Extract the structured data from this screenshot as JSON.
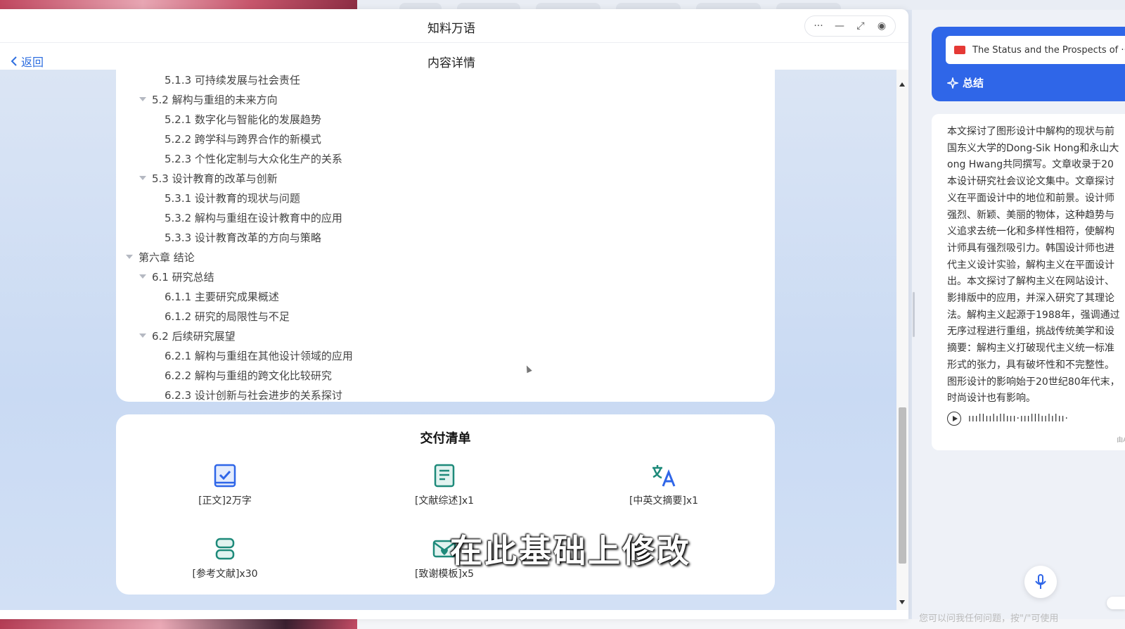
{
  "window": {
    "app_title": "知料万语",
    "controls": {
      "more": "···",
      "minimize": "—",
      "maximize": "⤢",
      "record": "◉"
    }
  },
  "nav": {
    "back_label": "返回",
    "title": "内容详情"
  },
  "toc": [
    {
      "level": 3,
      "text": "5.1.3 可持续发展与社会责任"
    },
    {
      "level": 2,
      "text": "5.2 解构与重组的未来方向"
    },
    {
      "level": 3,
      "text": "5.2.1 数字化与智能化的发展趋势"
    },
    {
      "level": 3,
      "text": "5.2.2 跨学科与跨界合作的新模式"
    },
    {
      "level": 3,
      "text": "5.2.3 个性化定制与大众化生产的关系"
    },
    {
      "level": 2,
      "text": "5.3 设计教育的改革与创新"
    },
    {
      "level": 3,
      "text": "5.3.1 设计教育的现状与问题"
    },
    {
      "level": 3,
      "text": "5.3.2 解构与重组在设计教育中的应用"
    },
    {
      "level": 3,
      "text": "5.3.3 设计教育改革的方向与策略"
    },
    {
      "level": 1,
      "text": "第六章 结论"
    },
    {
      "level": 2,
      "text": "6.1 研究总结"
    },
    {
      "level": 3,
      "text": "6.1.1 主要研究成果概述"
    },
    {
      "level": 3,
      "text": "6.1.2 研究的局限性与不足"
    },
    {
      "level": 2,
      "text": "6.2 后续研究展望"
    },
    {
      "level": 3,
      "text": "6.2.1 解构与重组在其他设计领域的应用"
    },
    {
      "level": 3,
      "text": "6.2.2 解构与重组的跨文化比较研究"
    },
    {
      "level": 3,
      "text": "6.2.3 设计创新与社会进步的关系探讨"
    }
  ],
  "deliverables": {
    "title": "交付清单",
    "items": [
      {
        "label": "[正文]2万字",
        "icon": "checked-book-icon"
      },
      {
        "label": "[文献综述]x1",
        "icon": "document-list-icon"
      },
      {
        "label": "[中英文摘要]x1",
        "icon": "translate-icon"
      },
      {
        "label": "[参考文献]x30",
        "icon": "bookmark-stack-icon"
      },
      {
        "label": "[致谢模板]x5",
        "icon": "heart-envelope-icon"
      }
    ]
  },
  "subtitle_overlay": "在此基础上修改",
  "right_panel": {
    "pdf_name": "The Status and the Prospects of ···",
    "summary_tag": "总结",
    "summary_lines": [
      "本文探讨了图形设计中解构的现状与前",
      "国东义大学的Dong-Sik Hong和永山大",
      "ong Hwang共同撰写。文章收录于20",
      "本设计研究社会议论文集中。文章探讨",
      "义在平面设计中的地位和前景。设计师",
      "强烈、新颖、美丽的物体，这种趋势与",
      "义追求去统一化和多样性相符，使解构",
      "计师具有强烈吸引力。韩国设计师也进",
      "代主义设计实验，解构主义在平面设计",
      "出。本文探讨了解构主义在网站设计、",
      "影排版中的应用，并深入研究了其理论",
      "法。解构主义起源于1988年，强调通过",
      "无序过程进行重组，挑战传统美学和设",
      "摘要：解构主义打破现代主义统一标准",
      "形式的张力，具有破坏性和不完整性。",
      "图形设计的影响始于20世纪80年代末，",
      "时尚设计也有影响。"
    ],
    "waveform": "ıııllıılıllııı·ııılllıılılıı·",
    "ai_note": "由AI自",
    "input_placeholder": "您可以问我任何问题，按\"/\"可使用"
  },
  "colors": {
    "accent": "#2f66e8",
    "icon_teal": "#1e8a7a",
    "icon_blue": "#2f66e8"
  }
}
